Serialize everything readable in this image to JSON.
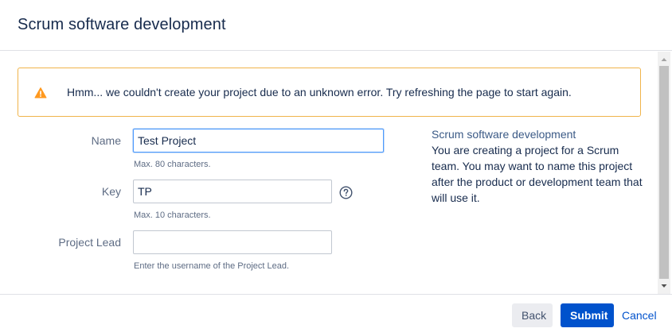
{
  "dialog": {
    "title": "Scrum software development"
  },
  "warning": {
    "icon": "warning-triangle-icon",
    "color": "#f0b44a",
    "message": "Hmm... we couldn't create your project due to an unknown error. Try refreshing the page to start again."
  },
  "form": {
    "name": {
      "label": "Name",
      "value": "Test Project",
      "help": "Max. 80 characters."
    },
    "key": {
      "label": "Key",
      "value": "TP",
      "help": "Max. 10 characters.",
      "help_icon": "question-circle-icon"
    },
    "project_lead": {
      "label": "Project Lead",
      "value": "",
      "help": "Enter the username of the Project Lead."
    }
  },
  "info": {
    "title": "Scrum software development",
    "description": "You are creating a project for a Scrum team. You may want to name this project after the product or development team that will use it."
  },
  "footer": {
    "back_label": "Back",
    "submit_label": "Submit",
    "cancel_label": "Cancel"
  },
  "colors": {
    "primary": "#0052cc",
    "warning_border": "#f0b44a",
    "focus_border": "#4c9aff"
  }
}
